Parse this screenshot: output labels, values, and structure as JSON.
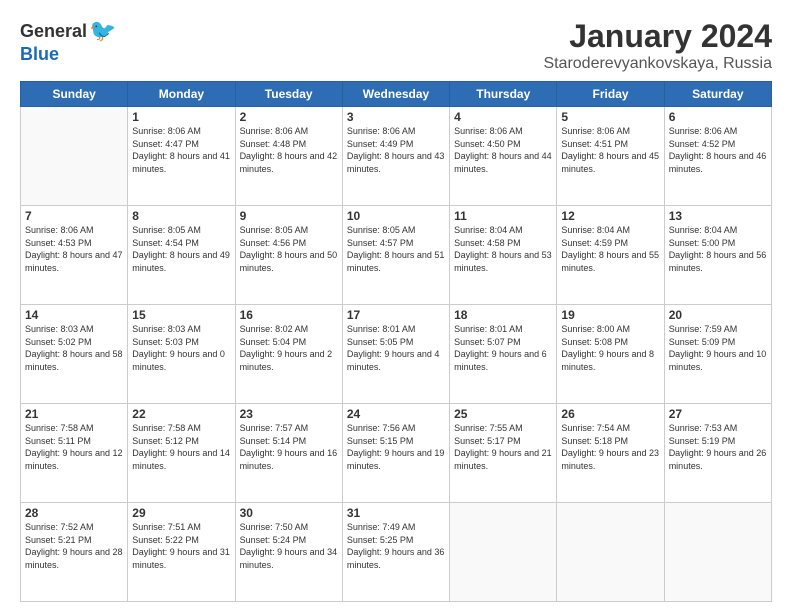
{
  "logo": {
    "general": "General",
    "blue": "Blue"
  },
  "title": "January 2024",
  "subtitle": "Staroderevyankovskaya, Russia",
  "days_header": [
    "Sunday",
    "Monday",
    "Tuesday",
    "Wednesday",
    "Thursday",
    "Friday",
    "Saturday"
  ],
  "weeks": [
    [
      {
        "day": "",
        "sunrise": "",
        "sunset": "",
        "daylight": ""
      },
      {
        "day": "1",
        "sunrise": "Sunrise: 8:06 AM",
        "sunset": "Sunset: 4:47 PM",
        "daylight": "Daylight: 8 hours and 41 minutes."
      },
      {
        "day": "2",
        "sunrise": "Sunrise: 8:06 AM",
        "sunset": "Sunset: 4:48 PM",
        "daylight": "Daylight: 8 hours and 42 minutes."
      },
      {
        "day": "3",
        "sunrise": "Sunrise: 8:06 AM",
        "sunset": "Sunset: 4:49 PM",
        "daylight": "Daylight: 8 hours and 43 minutes."
      },
      {
        "day": "4",
        "sunrise": "Sunrise: 8:06 AM",
        "sunset": "Sunset: 4:50 PM",
        "daylight": "Daylight: 8 hours and 44 minutes."
      },
      {
        "day": "5",
        "sunrise": "Sunrise: 8:06 AM",
        "sunset": "Sunset: 4:51 PM",
        "daylight": "Daylight: 8 hours and 45 minutes."
      },
      {
        "day": "6",
        "sunrise": "Sunrise: 8:06 AM",
        "sunset": "Sunset: 4:52 PM",
        "daylight": "Daylight: 8 hours and 46 minutes."
      }
    ],
    [
      {
        "day": "7",
        "sunrise": "Sunrise: 8:06 AM",
        "sunset": "Sunset: 4:53 PM",
        "daylight": "Daylight: 8 hours and 47 minutes."
      },
      {
        "day": "8",
        "sunrise": "Sunrise: 8:05 AM",
        "sunset": "Sunset: 4:54 PM",
        "daylight": "Daylight: 8 hours and 49 minutes."
      },
      {
        "day": "9",
        "sunrise": "Sunrise: 8:05 AM",
        "sunset": "Sunset: 4:56 PM",
        "daylight": "Daylight: 8 hours and 50 minutes."
      },
      {
        "day": "10",
        "sunrise": "Sunrise: 8:05 AM",
        "sunset": "Sunset: 4:57 PM",
        "daylight": "Daylight: 8 hours and 51 minutes."
      },
      {
        "day": "11",
        "sunrise": "Sunrise: 8:04 AM",
        "sunset": "Sunset: 4:58 PM",
        "daylight": "Daylight: 8 hours and 53 minutes."
      },
      {
        "day": "12",
        "sunrise": "Sunrise: 8:04 AM",
        "sunset": "Sunset: 4:59 PM",
        "daylight": "Daylight: 8 hours and 55 minutes."
      },
      {
        "day": "13",
        "sunrise": "Sunrise: 8:04 AM",
        "sunset": "Sunset: 5:00 PM",
        "daylight": "Daylight: 8 hours and 56 minutes."
      }
    ],
    [
      {
        "day": "14",
        "sunrise": "Sunrise: 8:03 AM",
        "sunset": "Sunset: 5:02 PM",
        "daylight": "Daylight: 8 hours and 58 minutes."
      },
      {
        "day": "15",
        "sunrise": "Sunrise: 8:03 AM",
        "sunset": "Sunset: 5:03 PM",
        "daylight": "Daylight: 9 hours and 0 minutes."
      },
      {
        "day": "16",
        "sunrise": "Sunrise: 8:02 AM",
        "sunset": "Sunset: 5:04 PM",
        "daylight": "Daylight: 9 hours and 2 minutes."
      },
      {
        "day": "17",
        "sunrise": "Sunrise: 8:01 AM",
        "sunset": "Sunset: 5:05 PM",
        "daylight": "Daylight: 9 hours and 4 minutes."
      },
      {
        "day": "18",
        "sunrise": "Sunrise: 8:01 AM",
        "sunset": "Sunset: 5:07 PM",
        "daylight": "Daylight: 9 hours and 6 minutes."
      },
      {
        "day": "19",
        "sunrise": "Sunrise: 8:00 AM",
        "sunset": "Sunset: 5:08 PM",
        "daylight": "Daylight: 9 hours and 8 minutes."
      },
      {
        "day": "20",
        "sunrise": "Sunrise: 7:59 AM",
        "sunset": "Sunset: 5:09 PM",
        "daylight": "Daylight: 9 hours and 10 minutes."
      }
    ],
    [
      {
        "day": "21",
        "sunrise": "Sunrise: 7:58 AM",
        "sunset": "Sunset: 5:11 PM",
        "daylight": "Daylight: 9 hours and 12 minutes."
      },
      {
        "day": "22",
        "sunrise": "Sunrise: 7:58 AM",
        "sunset": "Sunset: 5:12 PM",
        "daylight": "Daylight: 9 hours and 14 minutes."
      },
      {
        "day": "23",
        "sunrise": "Sunrise: 7:57 AM",
        "sunset": "Sunset: 5:14 PM",
        "daylight": "Daylight: 9 hours and 16 minutes."
      },
      {
        "day": "24",
        "sunrise": "Sunrise: 7:56 AM",
        "sunset": "Sunset: 5:15 PM",
        "daylight": "Daylight: 9 hours and 19 minutes."
      },
      {
        "day": "25",
        "sunrise": "Sunrise: 7:55 AM",
        "sunset": "Sunset: 5:17 PM",
        "daylight": "Daylight: 9 hours and 21 minutes."
      },
      {
        "day": "26",
        "sunrise": "Sunrise: 7:54 AM",
        "sunset": "Sunset: 5:18 PM",
        "daylight": "Daylight: 9 hours and 23 minutes."
      },
      {
        "day": "27",
        "sunrise": "Sunrise: 7:53 AM",
        "sunset": "Sunset: 5:19 PM",
        "daylight": "Daylight: 9 hours and 26 minutes."
      }
    ],
    [
      {
        "day": "28",
        "sunrise": "Sunrise: 7:52 AM",
        "sunset": "Sunset: 5:21 PM",
        "daylight": "Daylight: 9 hours and 28 minutes."
      },
      {
        "day": "29",
        "sunrise": "Sunrise: 7:51 AM",
        "sunset": "Sunset: 5:22 PM",
        "daylight": "Daylight: 9 hours and 31 minutes."
      },
      {
        "day": "30",
        "sunrise": "Sunrise: 7:50 AM",
        "sunset": "Sunset: 5:24 PM",
        "daylight": "Daylight: 9 hours and 34 minutes."
      },
      {
        "day": "31",
        "sunrise": "Sunrise: 7:49 AM",
        "sunset": "Sunset: 5:25 PM",
        "daylight": "Daylight: 9 hours and 36 minutes."
      },
      {
        "day": "",
        "sunrise": "",
        "sunset": "",
        "daylight": ""
      },
      {
        "day": "",
        "sunrise": "",
        "sunset": "",
        "daylight": ""
      },
      {
        "day": "",
        "sunrise": "",
        "sunset": "",
        "daylight": ""
      }
    ]
  ]
}
